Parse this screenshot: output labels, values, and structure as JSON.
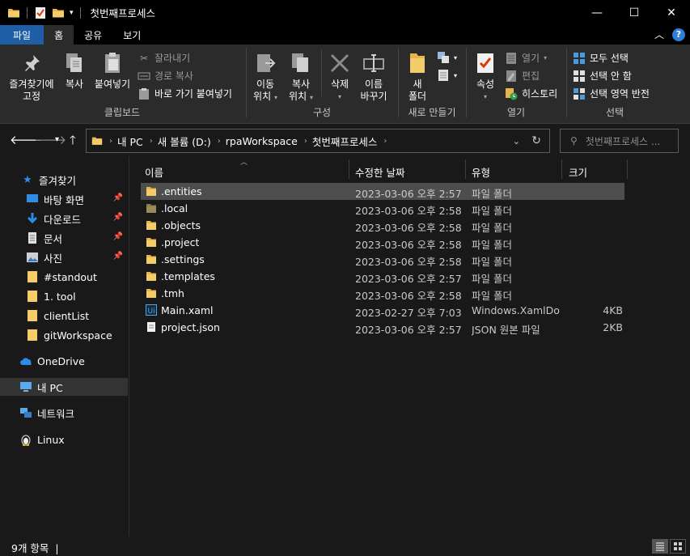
{
  "window": {
    "title": "첫번째프로세스",
    "minimize": "—",
    "maximize": "☐",
    "close": "✕"
  },
  "ribbon_tabs": [
    "파일",
    "홈",
    "공유",
    "보기"
  ],
  "ribbon": {
    "clipboard": {
      "pin_label": [
        "즐겨찾기에",
        "고정"
      ],
      "copy_label": "복사",
      "paste_label": "붙여넣기",
      "cut_label": "잘라내기",
      "copy_path_label": "경로 복사",
      "paste_shortcut_label": "바로 가기 붙여넣기",
      "group_label": "클립보드"
    },
    "organize": {
      "move_label": [
        "이동",
        "위치"
      ],
      "copy_to_label": [
        "복사",
        "위치"
      ],
      "delete_label": "삭제",
      "rename_label": [
        "이름",
        "바꾸기"
      ],
      "group_label": "구성"
    },
    "new": {
      "new_folder_label": [
        "새",
        "폴더"
      ],
      "group_label": "새로 만들기"
    },
    "open": {
      "properties_label": "속성",
      "open_label": "열기",
      "edit_label": "편집",
      "history_label": "히스토리",
      "group_label": "열기"
    },
    "select": {
      "select_all_label": "모두 선택",
      "select_none_label": "선택 안 함",
      "invert_label": "선택 영역 반전",
      "group_label": "선택"
    }
  },
  "address": {
    "crumbs": [
      "내 PC",
      "새 볼륨 (D:)",
      "rpaWorkspace",
      "첫번째프로세스"
    ],
    "search_placeholder": "첫번째프로세스 ..."
  },
  "nav_pane": {
    "quick_access": "즐겨찾기",
    "pinned": [
      {
        "label": "바탕 화면",
        "icon": "desktop-icon"
      },
      {
        "label": "다운로드",
        "icon": "download-icon"
      },
      {
        "label": "문서",
        "icon": "document-icon"
      },
      {
        "label": "사진",
        "icon": "pictures-icon"
      }
    ],
    "recent": [
      "#standout",
      "1. tool",
      "clientList",
      "gitWorkspace"
    ],
    "onedrive": "OneDrive",
    "this_pc": "내 PC",
    "network": "네트워크",
    "linux": "Linux"
  },
  "columns": {
    "name": "이름",
    "modified": "수정한 날짜",
    "type": "유형",
    "size": "크기"
  },
  "files": [
    {
      "name": ".entities",
      "modified": "2023-03-06 오후 2:57",
      "type": "파일 폴더",
      "size": "",
      "icon": "folder"
    },
    {
      "name": ".local",
      "modified": "2023-03-06 오후 2:58",
      "type": "파일 폴더",
      "size": "",
      "icon": "folder-dim"
    },
    {
      "name": ".objects",
      "modified": "2023-03-06 오후 2:58",
      "type": "파일 폴더",
      "size": "",
      "icon": "folder"
    },
    {
      "name": ".project",
      "modified": "2023-03-06 오후 2:58",
      "type": "파일 폴더",
      "size": "",
      "icon": "folder"
    },
    {
      "name": ".settings",
      "modified": "2023-03-06 오후 2:58",
      "type": "파일 폴더",
      "size": "",
      "icon": "folder"
    },
    {
      "name": ".templates",
      "modified": "2023-03-06 오후 2:57",
      "type": "파일 폴더",
      "size": "",
      "icon": "folder"
    },
    {
      "name": ".tmh",
      "modified": "2023-03-06 오후 2:58",
      "type": "파일 폴더",
      "size": "",
      "icon": "folder"
    },
    {
      "name": "Main.xaml",
      "modified": "2023-02-27 오후 7:03",
      "type": "Windows.XamlDo...",
      "size": "4KB",
      "icon": "uipath"
    },
    {
      "name": "project.json",
      "modified": "2023-03-06 오후 2:57",
      "type": "JSON 원본 파일",
      "size": "2KB",
      "icon": "file"
    }
  ],
  "status": {
    "count": "9개 항목",
    "divider": "|"
  },
  "colors": {
    "folder": "#e8b54a",
    "file_tab_bg": "#1e5ea6",
    "selected_row": "#4d4d4d"
  }
}
